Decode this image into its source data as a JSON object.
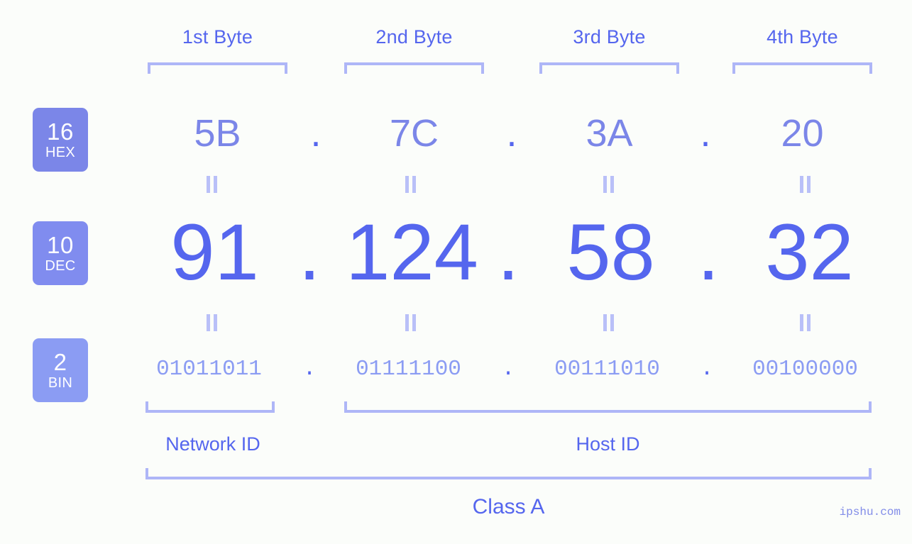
{
  "meta": {
    "background_color": "#fbfdfa",
    "accent_color": "#5566ee",
    "light_accent_color": "#aeb6f7",
    "watermark": "ipshu.com"
  },
  "byte_headers": [
    {
      "label": "1st Byte"
    },
    {
      "label": "2nd Byte"
    },
    {
      "label": "3rd Byte"
    },
    {
      "label": "4th Byte"
    }
  ],
  "rows": {
    "hex": {
      "badge_number": "16",
      "badge_system": "HEX",
      "badge_color": "#7b86e8",
      "separator": ".",
      "values": [
        "5B",
        "7C",
        "3A",
        "20"
      ]
    },
    "dec": {
      "badge_number": "10",
      "badge_system": "DEC",
      "badge_color": "#808cef",
      "separator": ".",
      "values": [
        "91",
        "124",
        "58",
        "32"
      ]
    },
    "bin": {
      "badge_number": "2",
      "badge_system": "BIN",
      "badge_color": "#8b9cf3",
      "separator": ".",
      "values": [
        "01011011",
        "01111100",
        "00111010",
        "00100000"
      ]
    }
  },
  "segments": {
    "network_id": "Network ID",
    "host_id": "Host ID",
    "ip_class": "Class A"
  }
}
